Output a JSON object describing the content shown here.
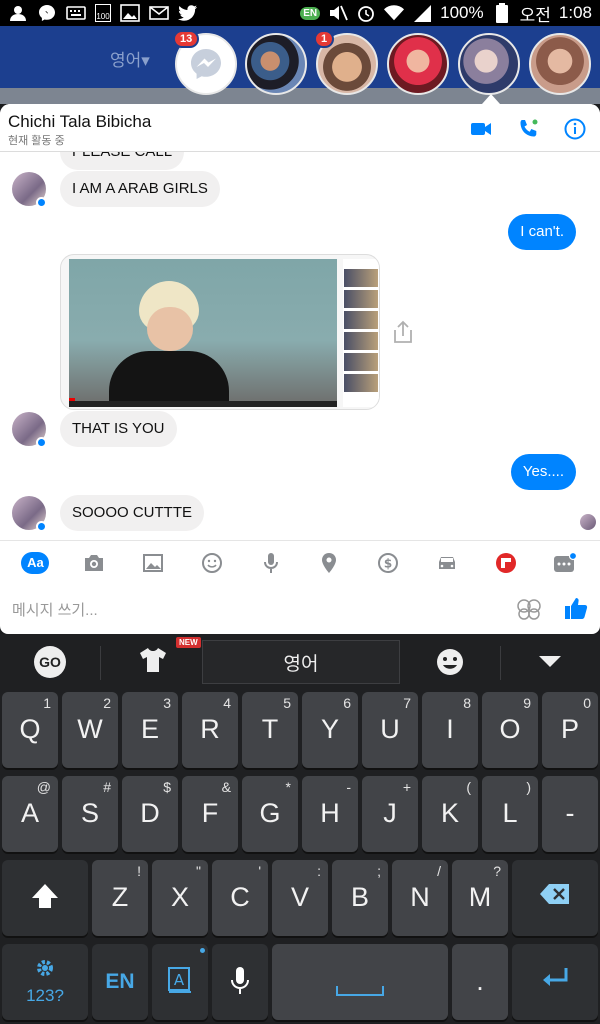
{
  "status_bar": {
    "battery": "100%",
    "ampm": "오전",
    "time": "1:08",
    "en_badge": "EN",
    "battery_small": "100"
  },
  "heads": {
    "lang_label": "영어▾",
    "messenger_badge": "13",
    "head2_badge": "1"
  },
  "chat": {
    "contact_name": "Chichi Tala Bibicha",
    "contact_status": "현재 활동 중",
    "messages": [
      {
        "side": "in",
        "text": "PLEASE CALL"
      },
      {
        "side": "in",
        "text": "I AM A ARAB GIRLS"
      },
      {
        "side": "out",
        "text": "I can't."
      },
      {
        "side": "in",
        "text": "THAT IS YOU"
      },
      {
        "side": "out",
        "text": "Yes...."
      },
      {
        "side": "in",
        "text": "SOOOO CUTTTE"
      }
    ],
    "composer": {
      "aa_label": "Aa",
      "placeholder": "메시지 쓰기..."
    }
  },
  "keyboard": {
    "language_label": "영어",
    "new_badge": "NEW",
    "go_label": "GO",
    "row1": [
      {
        "k": "Q",
        "h": "1"
      },
      {
        "k": "W",
        "h": "2"
      },
      {
        "k": "E",
        "h": "3"
      },
      {
        "k": "R",
        "h": "4"
      },
      {
        "k": "T",
        "h": "5"
      },
      {
        "k": "Y",
        "h": "6"
      },
      {
        "k": "U",
        "h": "7"
      },
      {
        "k": "I",
        "h": "8"
      },
      {
        "k": "O",
        "h": "9"
      },
      {
        "k": "P",
        "h": "0"
      }
    ],
    "row2": [
      {
        "k": "A",
        "h": "@"
      },
      {
        "k": "S",
        "h": "#"
      },
      {
        "k": "D",
        "h": "$"
      },
      {
        "k": "F",
        "h": "&"
      },
      {
        "k": "G",
        "h": "*"
      },
      {
        "k": "H",
        "h": "-"
      },
      {
        "k": "J",
        "h": "+"
      },
      {
        "k": "K",
        "h": "("
      },
      {
        "k": "L",
        "h": ")"
      },
      {
        "k": "-",
        "h": ""
      }
    ],
    "row3": [
      {
        "k": "Z",
        "h": "!"
      },
      {
        "k": "X",
        "h": "\""
      },
      {
        "k": "C",
        "h": "'"
      },
      {
        "k": "V",
        "h": ":"
      },
      {
        "k": "B",
        "h": ";"
      },
      {
        "k": "N",
        "h": "/"
      },
      {
        "k": "M",
        "h": "?"
      }
    ],
    "symbols_label": "123?",
    "lang_key_label": "EN",
    "period_label": "."
  }
}
